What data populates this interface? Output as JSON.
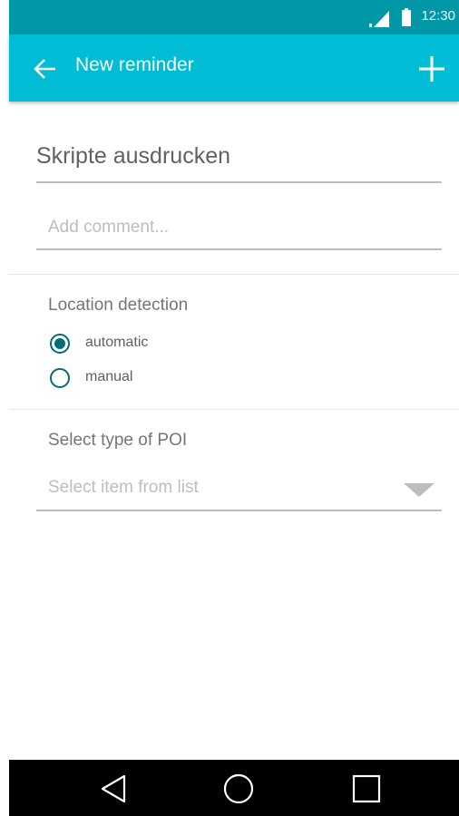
{
  "status_bar": {
    "time": "12:30"
  },
  "app_bar": {
    "title": "New reminder"
  },
  "form": {
    "title_value": "Skripte ausdrucken",
    "comment_placeholder": "Add comment...",
    "location_section_title": "Location detection",
    "location_options": [
      {
        "label": "automatic",
        "selected": true
      },
      {
        "label": "manual",
        "selected": false
      }
    ],
    "poi_section_title": "Select type of POI",
    "poi_placeholder": "Select item from list"
  },
  "colors": {
    "status_bar": "#0097a7",
    "app_bar": "#00bcd4",
    "radio_accent": "#006d77"
  }
}
